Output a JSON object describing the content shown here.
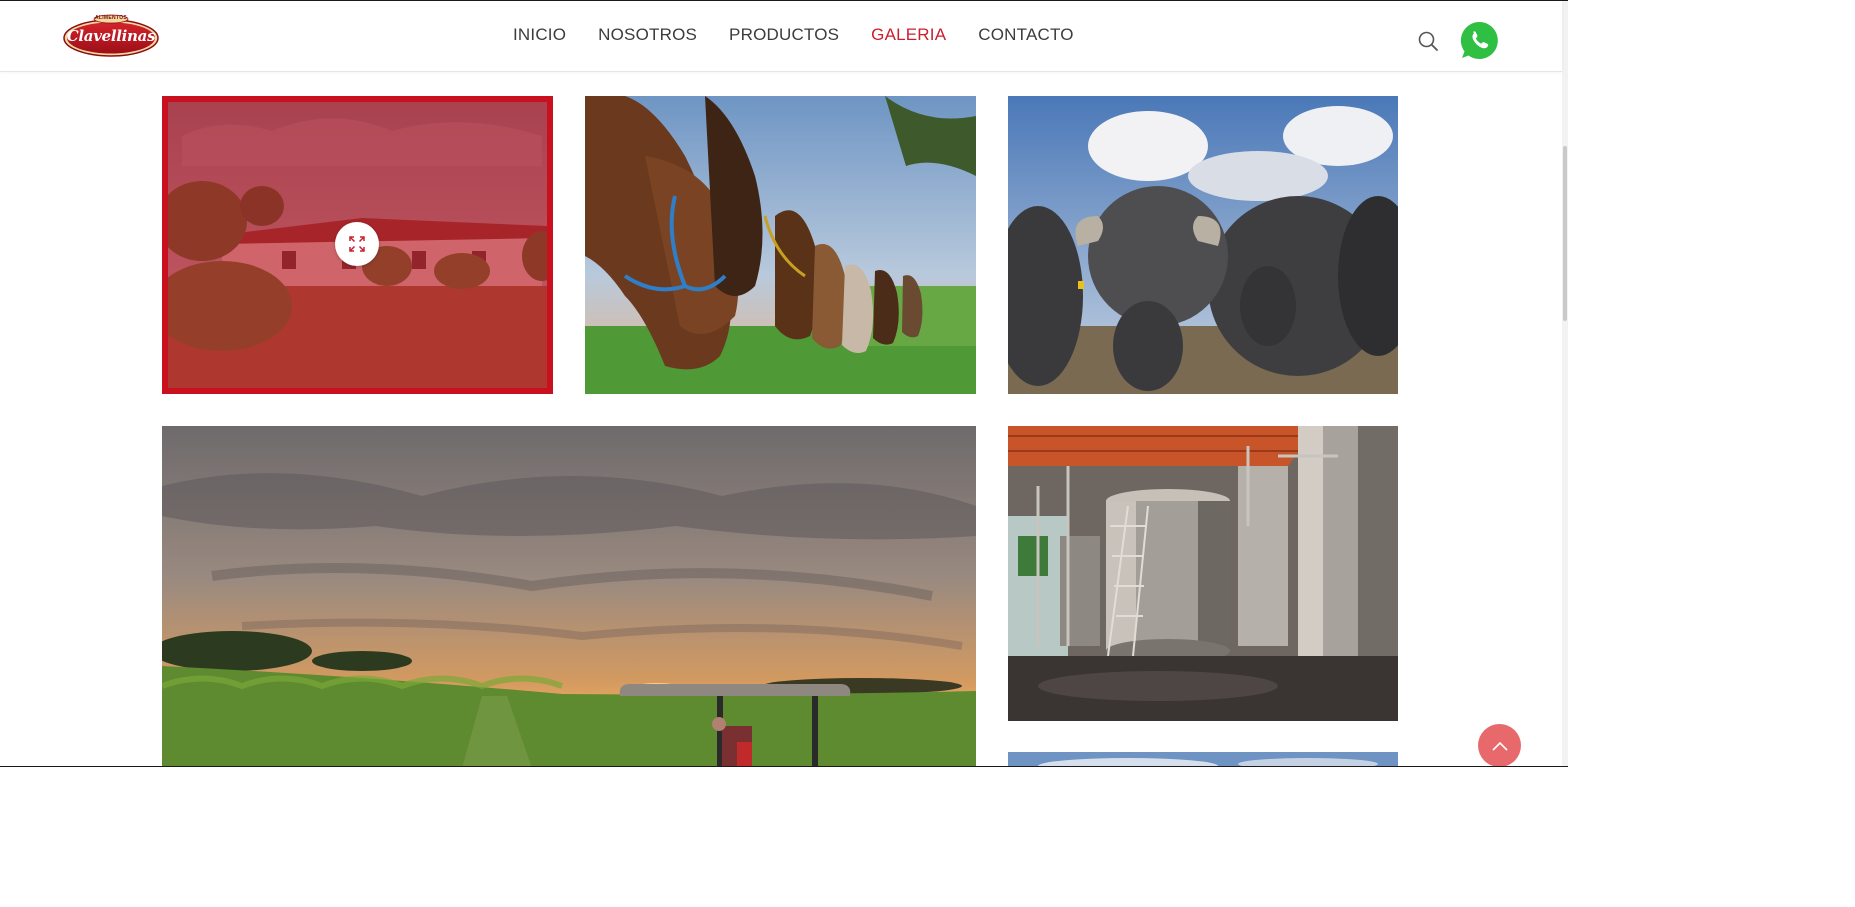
{
  "brand": {
    "name": "Clavellinas",
    "tagline": "ALIMENTOS",
    "colors": {
      "primary": "#c8202f",
      "logo_fill": "#b5121b"
    }
  },
  "nav": {
    "items": [
      {
        "label": "INICIO",
        "active": false
      },
      {
        "label": "NOSOTROS",
        "active": false
      },
      {
        "label": "PRODUCTOS",
        "active": false
      },
      {
        "label": "GALERIA",
        "active": true
      },
      {
        "label": "CONTACTO",
        "active": false
      }
    ]
  },
  "header_icons": {
    "search": "search-icon",
    "whatsapp": "whatsapp-icon",
    "whatsapp_color": "#2fbf43"
  },
  "gallery": {
    "images": [
      {
        "name": "farmhouse-photo",
        "hovered": true,
        "hover_icon": "expand-icon"
      },
      {
        "name": "horses-photo",
        "hovered": false
      },
      {
        "name": "water-buffalo-photo",
        "hovered": false
      },
      {
        "name": "sugarcane-field-tractor-photo",
        "hovered": false
      },
      {
        "name": "dairy-tanks-photo",
        "hovered": false
      },
      {
        "name": "sky-photo",
        "hovered": false
      }
    ]
  },
  "scroll_to_top": {
    "icon": "chevron-up-icon",
    "color": "#e8696c"
  }
}
